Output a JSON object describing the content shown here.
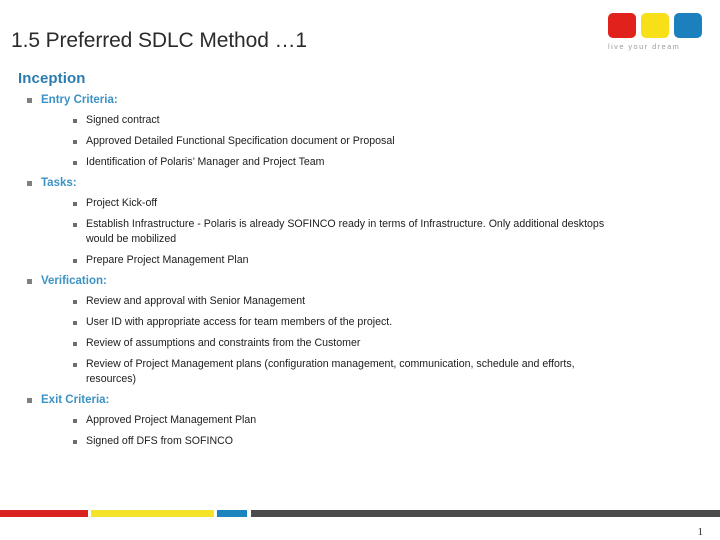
{
  "slide": {
    "title": "1.5 Preferred SDLC Method …1",
    "page_number": "1"
  },
  "logo": {
    "tagline": "live your dream",
    "colors": {
      "red": "#e0211c",
      "yellow": "#f7e018",
      "blue": "#1b80bd"
    }
  },
  "content": {
    "section_heading": "Inception",
    "groups": [
      {
        "label": "Entry Criteria:",
        "items": [
          "Signed contract",
          "Approved Detailed Functional Specification document or Proposal",
          "Identification of Polaris’ Manager and Project Team"
        ]
      },
      {
        "label": "Tasks:",
        "items": [
          "Project Kick-off",
          "Establish Infrastructure -  Polaris is already SOFINCO ready in terms of Infrastructure.  Only additional desktops would be mobilized",
          "Prepare Project Management Plan"
        ]
      },
      {
        "label": "Verification:",
        "items": [
          "Review and approval with Senior Management",
          "User ID with appropriate access for team members of the project.",
          "Review of assumptions and constraints from the Customer",
          "Review of Project Management  plans (configuration management, communication, schedule and efforts, resources)"
        ]
      },
      {
        "label": "Exit Criteria:",
        "items": [
          "Approved Project Management Plan",
          "Signed off DFS from SOFINCO"
        ]
      }
    ]
  },
  "footer": {
    "accent_colors": {
      "red": "#d8231f",
      "yellow": "#f5e32a",
      "blue": "#1b84bf",
      "dark": "#4b4b4b"
    }
  },
  "theme": {
    "heading_color": "#2a7cb0",
    "sub_heading_color": "#3c92c4",
    "title_color": "#2b2b2b",
    "body_text_color": "#1d1d1d"
  }
}
